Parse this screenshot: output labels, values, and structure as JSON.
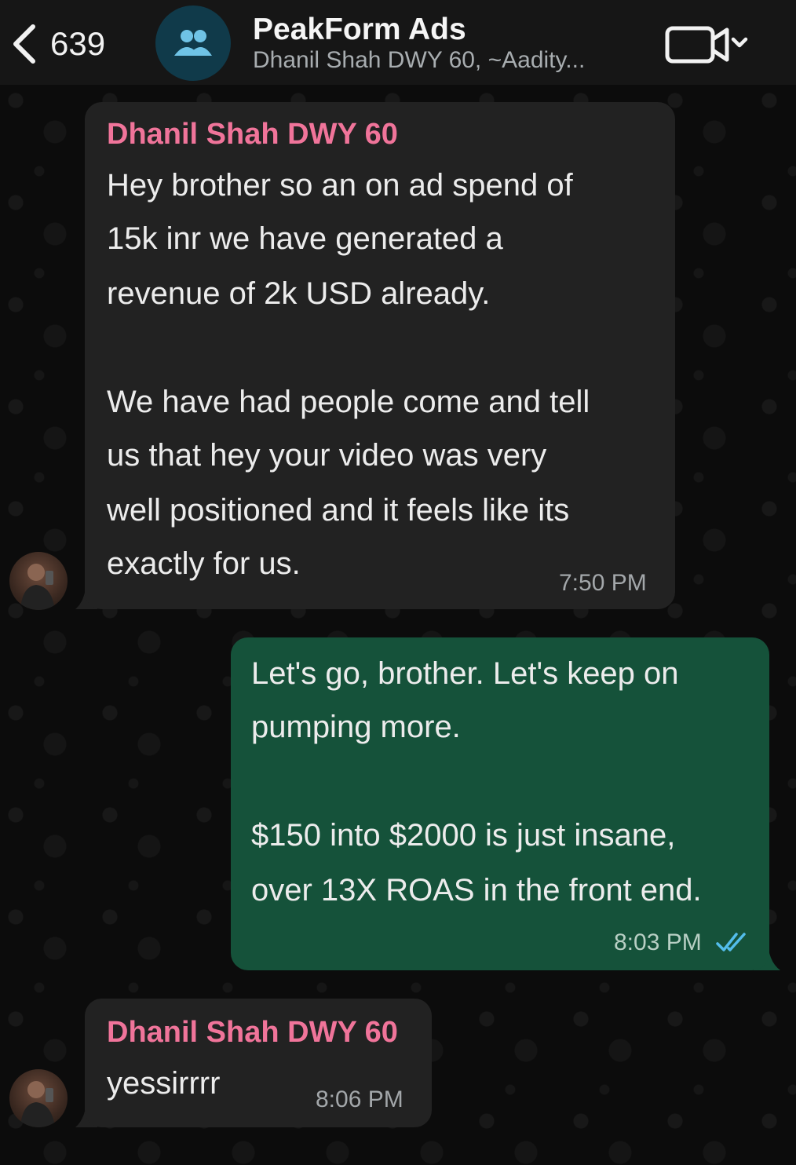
{
  "header": {
    "back_count": "639",
    "title": "PeakForm Ads",
    "subtitle": "Dhanil Shah DWY 60, ~Aadity...",
    "icons": [
      "back-chevron-icon",
      "group-icon",
      "video-call-icon",
      "chevron-down-icon"
    ]
  },
  "messages": [
    {
      "direction": "incoming",
      "sender": "Dhanil Shah DWY 60",
      "lines": [
        "Hey brother so an on ad spend of",
        "15k inr we have generated a",
        "revenue of 2k USD already.",
        "",
        "We have had people come and tell",
        "us that hey your video was very",
        "well positioned and it feels like its",
        "exactly for us."
      ],
      "time": "7:50 PM"
    },
    {
      "direction": "outgoing",
      "lines": [
        "Let's go, brother. Let's keep on",
        "pumping more.",
        "",
        "$150 into $2000 is just insane,",
        "over 13X ROAS in the front end."
      ],
      "time": "8:03 PM",
      "status": "read"
    },
    {
      "direction": "incoming",
      "sender": "Dhanil Shah DWY 60",
      "lines": [
        "yessirrrr"
      ],
      "time": "8:06 PM"
    }
  ],
  "colors": {
    "sender_name": "#f0749a",
    "incoming_bubble": "#222222",
    "outgoing_bubble": "#15523a",
    "read_ticks": "#53bdeb"
  }
}
